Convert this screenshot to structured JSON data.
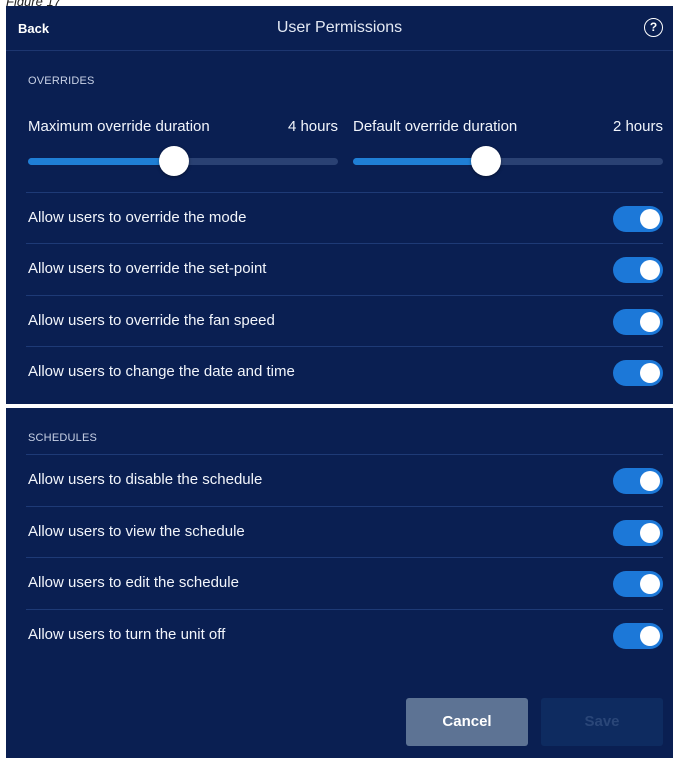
{
  "figure_caption": "Figure 17",
  "header": {
    "back_label": "Back",
    "title": "User Permissions",
    "help_glyph": "?"
  },
  "overrides": {
    "section_label": "OVERRIDES",
    "sliders": [
      {
        "label": "Maximum override duration",
        "value_text": "4 hours",
        "level": 0.47
      },
      {
        "label": "Default override duration",
        "value_text": "2 hours",
        "level": 0.43
      }
    ],
    "toggles": [
      {
        "label": "Allow users to override the mode",
        "on": true
      },
      {
        "label": "Allow users to override the set-point",
        "on": true
      },
      {
        "label": "Allow users to override the fan speed",
        "on": true
      },
      {
        "label": "Allow users to change the date and time",
        "on": true
      }
    ]
  },
  "schedules": {
    "section_label": "SCHEDULES",
    "toggles": [
      {
        "label": "Allow users to disable the schedule",
        "on": true
      },
      {
        "label": "Allow users to view the schedule",
        "on": true
      },
      {
        "label": "Allow users to edit the schedule",
        "on": true
      },
      {
        "label": "Allow users to turn the unit off",
        "on": true
      }
    ]
  },
  "actions": {
    "cancel_label": "Cancel",
    "save_label": "Save"
  },
  "colors": {
    "panel_bg": "#0a1f52",
    "accent": "#1c78d8",
    "cancel_bg": "#5d7394",
    "save_bg_disabled": "#0e2b60"
  }
}
